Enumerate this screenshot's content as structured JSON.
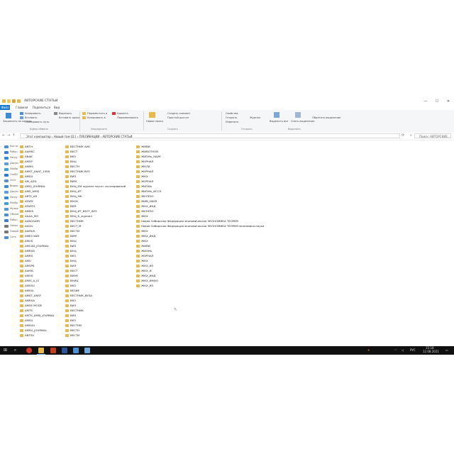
{
  "window": {
    "title": "АВТОРСКИЕ СТАТЬИ",
    "controls": {
      "minimize": "—",
      "maximize": "☐",
      "close": "✕"
    }
  },
  "ribbon_tabs": [
    "Файл",
    "Главная",
    "Поделиться",
    "Вид"
  ],
  "ribbon": {
    "pin_label": "Закрепить на панели",
    "copy_label": "Копировать",
    "paste_label": "Вставить",
    "cut_label": "Вырезать",
    "copy_path_label": "Скопировать путь",
    "paste_shortcut_label": "Вставить ярлык",
    "move_label": "Переместить в",
    "copy_to_label": "Копировать в",
    "delete_label": "Удалить",
    "rename_label": "Переименовать",
    "new_folder_label": "Новая папка",
    "new_item_label": "Создать элемент",
    "easy_access_label": "Простой доступ",
    "properties_label": "Свойства",
    "open_label": "Открыть",
    "edit_label": "Изменить",
    "history_label": "Журнал",
    "select_all_label": "Выделить все",
    "select_none_label": "Снять выделение",
    "invert_label": "Обратить выделение",
    "groups": [
      "Буфер обмена",
      "Упорядочить",
      "Создать",
      "Открыть",
      "Выделить"
    ]
  },
  "address": {
    "path": "Этот компьютер  ›  Новый том (D:)  ›  ПУБЛИКАЦИИ  ›  АВТОРСКИЕ СТАТЬИ",
    "search_placeholder": "Поиск: АВТОРСКИЕ..."
  },
  "nav_pane": [
    {
      "label": "Быстр",
      "color": "#4a90d9"
    },
    {
      "label": "Рабоч",
      "color": "#3c7fd1"
    },
    {
      "label": "Загру",
      "color": "#2f8ad8"
    },
    {
      "label": "Докум",
      "color": "#5a9ee0"
    },
    {
      "label": "Изобр",
      "color": "#3aa0d6"
    },
    {
      "label": "OneDr",
      "color": "#2b7bd3"
    },
    {
      "label": "Этот",
      "color": "#5a8fc8"
    },
    {
      "label": "Видео",
      "color": "#3b8bd6"
    },
    {
      "label": "Докум",
      "color": "#5a9ee0"
    },
    {
      "label": "Загру",
      "color": "#2f8ad8"
    },
    {
      "label": "Изобр",
      "color": "#3aa0d6"
    },
    {
      "label": "Музык",
      "color": "#4e9ad8"
    },
    {
      "label": "Объем",
      "color": "#4a90d9"
    },
    {
      "label": "Рабоч",
      "color": "#3c7fd1"
    },
    {
      "label": "Локал",
      "color": "#777777"
    },
    {
      "label": "Новый",
      "color": "#777777"
    },
    {
      "label": "Сеть",
      "color": "#4a90d9"
    }
  ],
  "columns": [
    [
      "ANTH",
      "AAMSC",
      "ANAK",
      "AMSP",
      "AMMS",
      "AMST_ANAT_1956",
      "AMSU",
      "AM_AJTA",
      "AMSJ_JOURNAL",
      "AMS_AMSJ",
      "ARTY_AR",
      "ATARY",
      "ATARTS",
      "AMIKS",
      "AAAA_MO",
      "AANGSARY",
      "AAGIL",
      "AAMUS",
      "AMES WAY",
      "AMUS",
      "AMCAD_JOURNAL",
      "AMRSA",
      "AMRS",
      "AMU",
      "AMSPK",
      "AAMIC",
      "AMUS",
      "AMIS_A_IS",
      "AMSSU",
      "AMSSL",
      "AMST_ANSF",
      "AMRSA",
      "AMSE MODE",
      "AMTS",
      "AMTS_AMSJ_JOURNAL",
      "AMSU",
      "AMSUU",
      "AMSU_JOURNAL",
      "ANTSU"
    ],
    [
      "ВЕСТНИК АИС",
      "ВЕСТ",
      "ВКЗ",
      "ВНЦ",
      "ВЕСТН",
      "ВЕСТНИК ВУЗ",
      "ВИЗ",
      "ВИМ",
      "ВНЦ_ЕМ журнал научн. исследований",
      "ВНЦ_ИТ",
      "ВНЦ_МК",
      "ВНСК",
      "ВЕМ",
      "ВНЦ_ИТ_ВЕСТ_ВУЗ",
      "ВНЦ_Б_журнал",
      "ВЕСТНИК",
      "ВЕСТ_М",
      "ВЕСТИ",
      "ВИМ",
      "ВНЦ",
      "ВИЗ",
      "ВНЦ",
      "ВКЗ",
      "ВНЦ",
      "ВИЗ",
      "ВЕСТ",
      "ВИНЕ",
      "ВНИЦ",
      "ВКЗ",
      "ВЕЗИЕ",
      "ВЕСТНИК_ВУЗА",
      "ВКЗ",
      "ВИЗ",
      "ВЕСТНИК",
      "ВИЗ",
      "ВКЗ",
      "ВЕСТНИ",
      "ВЕСТН",
      "ВЕСТИ"
    ],
    [
      "ЖИВИ",
      "ЖИВОТНОВ",
      "ЖИЗНЬ_НАУК",
      "ЖУРНАЛ",
      "ЖКЛА",
      "ЖУРНАЛ",
      "ЖКХ",
      "ЖУРНАЛ",
      "ЖИЗНЬ",
      "ЖИЗНЬ_ИССЛ",
      "ЖЕЛЕЗО",
      "ЖИВ_НАУК",
      "ЖКХ_ИНД",
      "ЖЕЛЕЗО",
      "ЖКХ",
      "Новая Сибирская Федерация экономическая ЭКОНОМИКА ТЕОРИЯ",
      "Новая Сибирская Федерация экономическая ЭКОНОМИКА ТЕОРИЯ экономика-наука",
      "ЖКХ",
      "ЖКХ_ИНД",
      "ЖКХ",
      "ЖИВИ",
      "ЖИЗНЬ",
      "ЖУРНАЛ",
      "ЖКХ",
      "ЖКХ_ИЗ",
      "ЖКХ_И",
      "ЖКХ_ИНД",
      "ЖКХ_ИНФО",
      "ЖКХ_ИЗ"
    ]
  ],
  "status": {
    "items_count": "Элементов: 106"
  },
  "taskbar": {
    "start": "⊞",
    "search": "⌕",
    "lang": "РУС",
    "time": "15:18",
    "date": "12.08.2021"
  }
}
